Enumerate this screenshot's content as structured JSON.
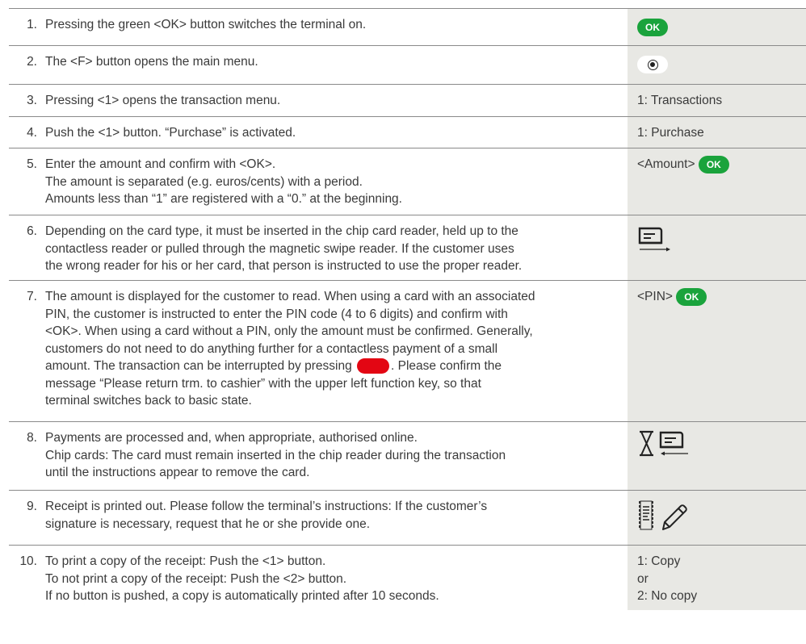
{
  "ok_label": "OK",
  "rows": [
    {
      "num": "1.",
      "lines": [
        "Pressing the green <OK> button switches the terminal on."
      ],
      "side_icon": "ok-button"
    },
    {
      "num": "2.",
      "lines": [
        "The <F> button opens the main menu."
      ],
      "side_icon": "f-button"
    },
    {
      "num": "3.",
      "lines": [
        "Pressing <1> opens the transaction menu."
      ],
      "side_text": [
        "1: Transactions"
      ]
    },
    {
      "num": "4.",
      "lines": [
        "Push the <1> button. “Purchase” is activated."
      ],
      "side_text": [
        "1: Purchase"
      ]
    },
    {
      "num": "5.",
      "lines": [
        "Enter the amount and confirm with <OK>.",
        "The amount is separated (e.g. euros/cents) with a period.",
        "Amounts less than “1” are registered with a “0.” at the beginning."
      ],
      "side_prefix": "<Amount>"
    },
    {
      "num": "6.",
      "lines": [
        "Depending on the card type, it must be inserted in the chip card reader, held up to the",
        "contactless reader or pulled through the magnetic swipe reader. If the customer uses",
        "the wrong reader for his or her card, that person is instructed to use the proper reader."
      ],
      "side_icon": "card-insert-icon"
    },
    {
      "num": "7.",
      "lines": [
        "The amount is displayed for the customer to read. When using a card with an associated",
        "PIN, the customer is instructed to enter the PIN code (4 to 6 digits) and confirm with",
        "<OK>. When using a card without a PIN, only the amount must be confirmed. Generally,",
        "customers do not need to do anything further for a contactless payment of a small"
      ],
      "line_red_before": "amount. The transaction can be interrupted by pressing",
      "line_red_after": ". Please confirm the",
      "lines_after": [
        "message “Please return trm. to cashier” with the upper left function key, so that",
        "terminal switches back to basic state."
      ],
      "side_prefix": "<PIN>"
    },
    {
      "num": "8.",
      "lines": [
        "Payments are processed and, when appropriate, authorised online.",
        "Chip cards: The card must remain inserted in the chip reader during the transaction",
        "until the instructions appear to remove the card."
      ],
      "side_icon": "hourglass-card-remove-icon"
    },
    {
      "num": "9.",
      "lines": [
        "Receipt is printed out. Please follow the terminal’s instructions: If the customer’s",
        "signature is necessary, request that he or she provide one."
      ],
      "side_icon": "receipt-pen-icon"
    },
    {
      "num": "10.",
      "lines": [
        "To print a copy of the receipt: Push the <1> button.",
        "To not print a copy of the receipt: Push the <2> button.",
        "If no button is pushed, a copy is automatically printed after 10 seconds."
      ],
      "side_text": [
        "1: Copy",
        "or",
        "2: No copy"
      ]
    }
  ]
}
